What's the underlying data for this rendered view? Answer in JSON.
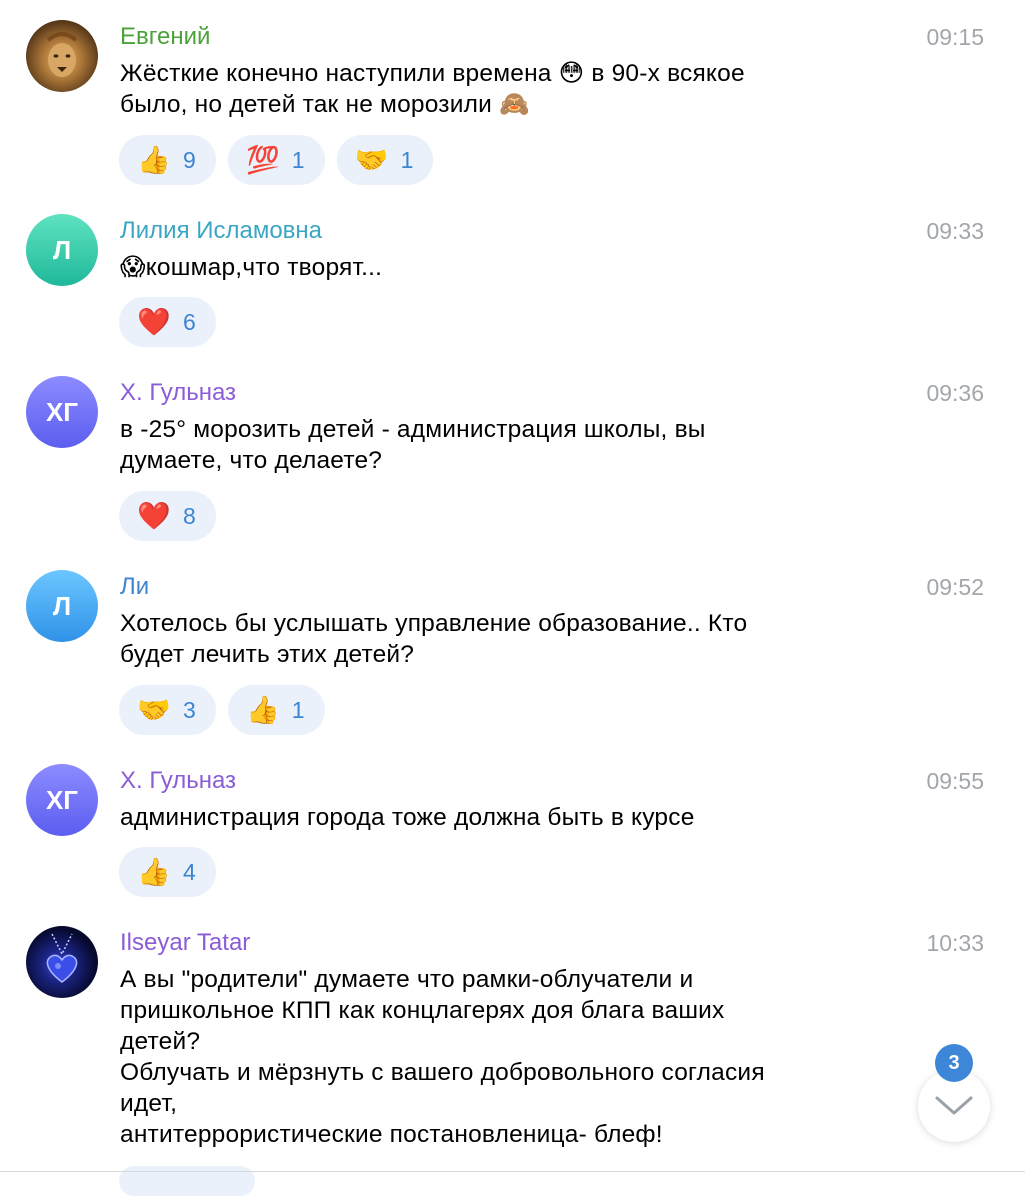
{
  "messages": [
    {
      "name": "Евгений",
      "name_color": "#4ca23a",
      "time": "09:15",
      "avatar": {
        "type": "image",
        "icon": "lion-avatar"
      },
      "lines": [
        "Жёсткие конечно наступили времена 😳 в 90-х всякое",
        "было, но детей так не морозили 🙈"
      ],
      "reactions": [
        {
          "emoji": "👍",
          "icon": "thumbs-up-icon",
          "count": "9"
        },
        {
          "emoji": "💯",
          "icon": "hundred-icon",
          "count": "1"
        },
        {
          "emoji": "🤝",
          "icon": "handshake-icon",
          "count": "1"
        }
      ]
    },
    {
      "name": "Лилия Исламовна",
      "name_color": "#3ba6c4",
      "time": "09:33",
      "avatar": {
        "type": "initials",
        "text": "Л",
        "color_top": "#5fe3c0",
        "color_bottom": "#1fb89a"
      },
      "lines": [
        "😱кошмар,что творят..."
      ],
      "reactions": [
        {
          "emoji": "❤️",
          "icon": "heart-icon",
          "count": "6"
        }
      ]
    },
    {
      "name": "Х. Гульназ",
      "name_color": "#8a5cd6",
      "time": "09:36",
      "avatar": {
        "type": "initials",
        "text": "ХГ",
        "color_top": "#8d8bff",
        "color_bottom": "#5b5ef0"
      },
      "lines": [
        "в -25° морозить детей - администрация школы, вы",
        "думаете, что делаете?"
      ],
      "reactions": [
        {
          "emoji": "❤️",
          "icon": "heart-icon",
          "count": "8"
        }
      ]
    },
    {
      "name": "Ли",
      "name_color": "#3d84d1",
      "time": "09:52",
      "avatar": {
        "type": "initials",
        "text": "Л",
        "color_top": "#6cc6ff",
        "color_bottom": "#2f92e8"
      },
      "lines": [
        "Хотелось бы услышать управление образование.. Кто",
        "будет лечить этих детей?"
      ],
      "reactions": [
        {
          "emoji": "🤝",
          "icon": "handshake-icon",
          "count": "3"
        },
        {
          "emoji": "👍",
          "icon": "thumbs-up-icon",
          "count": "1"
        }
      ]
    },
    {
      "name": "Х. Гульназ",
      "name_color": "#8a5cd6",
      "time": "09:55",
      "avatar": {
        "type": "initials",
        "text": "ХГ",
        "color_top": "#8d8bff",
        "color_bottom": "#5b5ef0"
      },
      "lines": [
        "администрация города тоже должна быть в курсе"
      ],
      "reactions": [
        {
          "emoji": "👍",
          "icon": "thumbs-up-icon",
          "count": "4"
        }
      ]
    },
    {
      "name": "Ilseyar Tatar",
      "name_color": "#8a5cd6",
      "time": "10:33",
      "avatar": {
        "type": "image",
        "icon": "heart-pendant-avatar"
      },
      "lines": [
        "А вы \"родители\" думаете что рамки-облучатели и",
        "пришкольное КПП как концлагерях доя блага ваших",
        "детей?",
        "Облучать и мёрзнуть с вашего добровольного согласия",
        "идет,",
        "антитеррористические постановленица- блеф!"
      ],
      "reactions": []
    }
  ],
  "scroll_down": {
    "icon": "chevron-down-icon",
    "unread_count": "3"
  }
}
